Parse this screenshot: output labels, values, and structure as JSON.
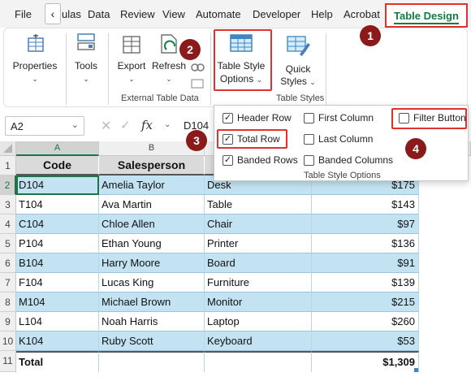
{
  "menubar": {
    "items": [
      "File",
      "‹",
      "ulas",
      "Data",
      "Review",
      "View",
      "Automate",
      "Developer",
      "Help",
      "Acrobat"
    ],
    "active_tab": "Table Design"
  },
  "ribbon": {
    "properties_label": "Properties",
    "tools_label": "Tools",
    "export_label": "Export",
    "refresh_label": "Refresh",
    "external_group": "External Table Data",
    "style_options_label_1": "Table Style",
    "style_options_label_2": "Options",
    "quick_styles_label_1": "Quick",
    "quick_styles_label_2": "Styles",
    "table_styles_group": "Table Styles"
  },
  "formula_bar": {
    "name_box": "A2",
    "fx": "fx",
    "value": "D104"
  },
  "style_options": {
    "header_row": {
      "label": "Header Row",
      "checked": true
    },
    "total_row": {
      "label": "Total Row",
      "checked": true
    },
    "banded_rows": {
      "label": "Banded Rows",
      "checked": true
    },
    "first_column": {
      "label": "First Column",
      "checked": false
    },
    "last_column": {
      "label": "Last Column",
      "checked": false
    },
    "banded_columns": {
      "label": "Banded Columns",
      "checked": false
    },
    "filter_button": {
      "label": "Filter Button",
      "checked": false
    },
    "group_label": "Table Style Options"
  },
  "markers": [
    "1",
    "2",
    "3",
    "4"
  ],
  "grid": {
    "columns": [
      "A",
      "B"
    ],
    "row_numbers": [
      "1",
      "2",
      "3",
      "4",
      "5",
      "6",
      "7",
      "8",
      "9",
      "10",
      "11"
    ],
    "headers": [
      "Code",
      "Salesperson"
    ],
    "rows": [
      [
        "D104",
        "Amelia Taylor",
        "Desk",
        "$175"
      ],
      [
        "T104",
        "Ava Martin",
        "Table",
        "$143"
      ],
      [
        "C104",
        "Chloe Allen",
        "Chair",
        "$97"
      ],
      [
        "P104",
        "Ethan Young",
        "Printer",
        "$136"
      ],
      [
        "B104",
        "Harry Moore",
        "Board",
        "$91"
      ],
      [
        "F104",
        "Lucas King",
        "Furniture",
        "$139"
      ],
      [
        "M104",
        "Michael Brown",
        "Monitor",
        "$215"
      ],
      [
        "L104",
        "Noah Harris",
        "Laptop",
        "$260"
      ],
      [
        "K104",
        "Ruby Scott",
        "Keyboard",
        "$53"
      ]
    ],
    "total_label": "Total",
    "total_value": "$1,309"
  },
  "colors": {
    "accent": "#107c41",
    "highlight": "#e0302f",
    "marker": "#8b1a1a",
    "band": "#c3e3f3"
  }
}
